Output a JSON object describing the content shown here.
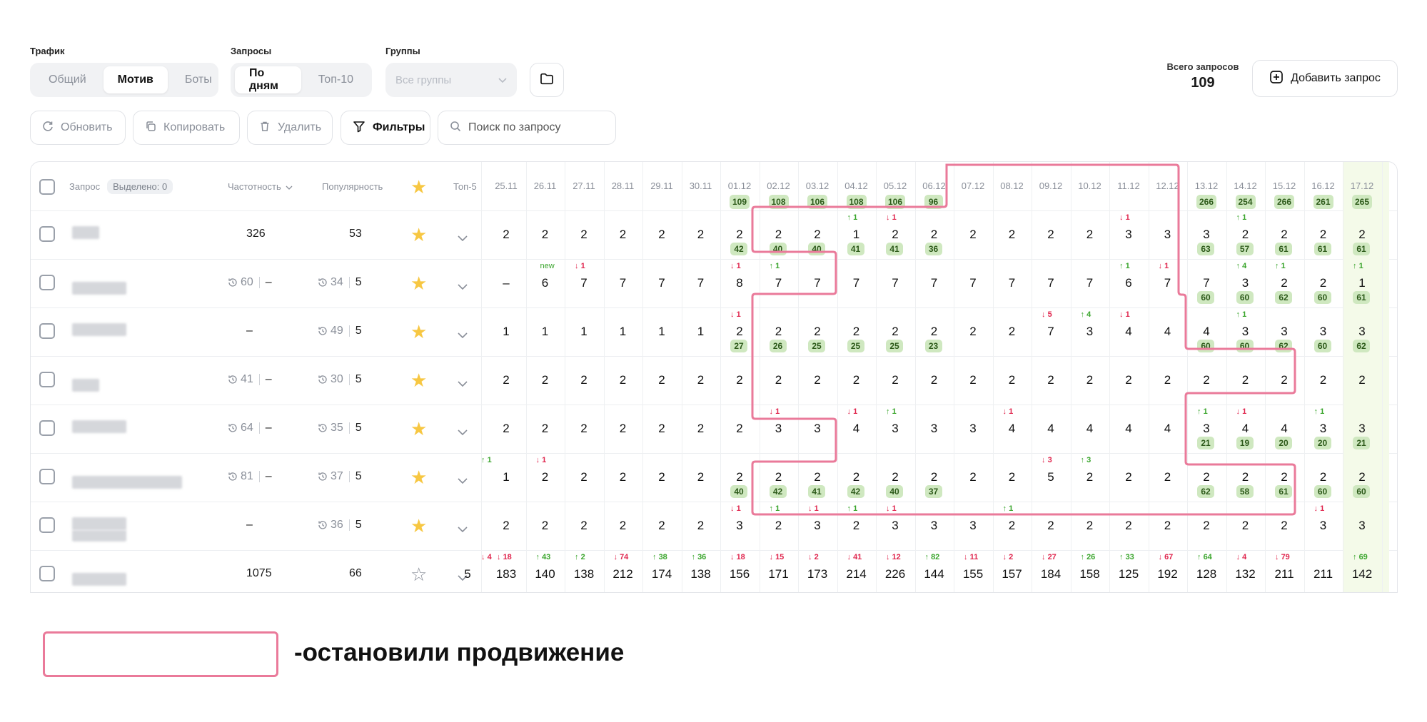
{
  "filters": {
    "traffic": {
      "label": "Трафик",
      "options": [
        "Общий",
        "Мотив",
        "Боты"
      ],
      "active": 1
    },
    "requests": {
      "label": "Запросы",
      "options": [
        "По дням",
        "Топ-10"
      ],
      "active": 0
    },
    "groups": {
      "label": "Группы",
      "placeholder": "Все группы"
    }
  },
  "summary": {
    "label": "Всего запросов",
    "value": "109"
  },
  "add_button": "Добавить запрос",
  "toolbar": {
    "refresh": "Обновить",
    "copy": "Копировать",
    "delete": "Удалить",
    "filters": "Фильтры",
    "search_placeholder": "Поиск по запросу"
  },
  "table": {
    "headers": {
      "query": "Запрос",
      "selected": "Выделено: 0",
      "frequency": "Частотность",
      "popularity": "Популярность",
      "top5": "Топ-5"
    },
    "dates": [
      "25.11",
      "26.11",
      "27.11",
      "28.11",
      "29.11",
      "30.11",
      "01.12",
      "02.12",
      "03.12",
      "04.12",
      "05.12",
      "06.12",
      "07.12",
      "08.12",
      "09.12",
      "10.12",
      "11.12",
      "12.12",
      "13.12",
      "14.12",
      "15.12",
      "16.12",
      "17.12"
    ],
    "date_badges": [
      "",
      "",
      "",
      "",
      "",
      "",
      "109",
      "108",
      "106",
      "108",
      "106",
      "96",
      "",
      "",
      "",
      "",
      "",
      "",
      "266",
      "254",
      "266",
      "261",
      "265"
    ],
    "rows": [
      {
        "freq": "326",
        "freq_hist": false,
        "freq_val": "",
        "pop": "53",
        "pop_hist": false,
        "pop_val": "",
        "star": true,
        "values": [
          "2",
          "2",
          "2",
          "2",
          "2",
          "2",
          "2",
          "2",
          "2",
          "1",
          "2",
          "2",
          "2",
          "2",
          "2",
          "2",
          "3",
          "3",
          "3",
          "2",
          "2",
          "2",
          "2"
        ],
        "badges": [
          "",
          "",
          "",
          "",
          "",
          "",
          "42",
          "40",
          "40",
          "41",
          "41",
          "36",
          "",
          "",
          "",
          "",
          "",
          "",
          "63",
          "57",
          "61",
          "61",
          "61"
        ],
        "deltas": {
          "9": [
            "up",
            "1"
          ],
          "10": [
            "down",
            "1"
          ],
          "16": [
            "down",
            "1"
          ],
          "19": [
            "up",
            "1"
          ]
        }
      },
      {
        "freq": "60",
        "freq_hist": true,
        "freq_val": "–",
        "pop": "34",
        "pop_hist": true,
        "pop_val": "5",
        "star": true,
        "values": [
          "–",
          "6",
          "7",
          "7",
          "7",
          "7",
          "8",
          "7",
          "7",
          "7",
          "7",
          "7",
          "7",
          "7",
          "7",
          "7",
          "6",
          "7",
          "7",
          "3",
          "2",
          "2",
          "1"
        ],
        "badges": [
          "",
          "",
          "",
          "",
          "",
          "",
          "",
          "",
          "",
          "",
          "",
          "",
          "",
          "",
          "",
          "",
          "",
          "",
          "60",
          "60",
          "62",
          "60",
          "61"
        ],
        "deltas": {
          "1": [
            "new",
            "new"
          ],
          "2": [
            "down",
            "1"
          ],
          "6": [
            "down",
            "1"
          ],
          "7": [
            "up",
            "1"
          ],
          "16": [
            "up",
            "1"
          ],
          "17": [
            "down",
            "1"
          ],
          "19": [
            "up",
            "4"
          ],
          "20": [
            "up",
            "1"
          ],
          "22": [
            "up",
            "1"
          ]
        }
      },
      {
        "freq": "–",
        "freq_hist": false,
        "freq_val": "",
        "pop": "49",
        "pop_hist": true,
        "pop_val": "5",
        "star": true,
        "values": [
          "1",
          "1",
          "1",
          "1",
          "1",
          "1",
          "2",
          "2",
          "2",
          "2",
          "2",
          "2",
          "2",
          "2",
          "7",
          "3",
          "4",
          "4",
          "4",
          "3",
          "3",
          "3",
          "3"
        ],
        "badges": [
          "",
          "",
          "",
          "",
          "",
          "",
          "27",
          "26",
          "25",
          "25",
          "25",
          "23",
          "",
          "",
          "",
          "",
          "",
          "",
          "60",
          "60",
          "62",
          "60",
          "62"
        ],
        "deltas": {
          "6": [
            "down",
            "1"
          ],
          "14": [
            "down",
            "5"
          ],
          "15": [
            "up",
            "4"
          ],
          "16": [
            "down",
            "1"
          ],
          "19": [
            "up",
            "1"
          ]
        }
      },
      {
        "freq": "41",
        "freq_hist": true,
        "freq_val": "–",
        "pop": "30",
        "pop_hist": true,
        "pop_val": "5",
        "star": true,
        "values": [
          "2",
          "2",
          "2",
          "2",
          "2",
          "2",
          "2",
          "2",
          "2",
          "2",
          "2",
          "2",
          "2",
          "2",
          "2",
          "2",
          "2",
          "2",
          "2",
          "2",
          "2",
          "2",
          "2"
        ],
        "badges": [
          "",
          "",
          "",
          "",
          "",
          "",
          "",
          "",
          "",
          "",
          "",
          "",
          "",
          "",
          "",
          "",
          "",
          "",
          "",
          "",
          "",
          "",
          ""
        ],
        "deltas": {}
      },
      {
        "freq": "64",
        "freq_hist": true,
        "freq_val": "–",
        "pop": "35",
        "pop_hist": true,
        "pop_val": "5",
        "star": true,
        "values": [
          "2",
          "2",
          "2",
          "2",
          "2",
          "2",
          "2",
          "3",
          "3",
          "4",
          "3",
          "3",
          "3",
          "4",
          "4",
          "4",
          "4",
          "4",
          "3",
          "4",
          "4",
          "3",
          "3"
        ],
        "badges": [
          "",
          "",
          "",
          "",
          "",
          "",
          "",
          "",
          "",
          "",
          "",
          "",
          "",
          "",
          "",
          "",
          "",
          "",
          "21",
          "19",
          "20",
          "20",
          "21"
        ],
        "deltas": {
          "7": [
            "down",
            "1"
          ],
          "9": [
            "down",
            "1"
          ],
          "10": [
            "up",
            "1"
          ],
          "13": [
            "down",
            "1"
          ],
          "18": [
            "up",
            "1"
          ],
          "19": [
            "down",
            "1"
          ],
          "21": [
            "up",
            "1"
          ]
        }
      },
      {
        "freq": "81",
        "freq_hist": true,
        "freq_val": "–",
        "pop": "37",
        "pop_hist": true,
        "pop_val": "5",
        "star": true,
        "values": [
          "1",
          "2",
          "2",
          "2",
          "2",
          "2",
          "2",
          "2",
          "2",
          "2",
          "2",
          "2",
          "2",
          "2",
          "5",
          "2",
          "2",
          "2",
          "2",
          "2",
          "2",
          "2",
          "2"
        ],
        "badges": [
          "",
          "",
          "",
          "",
          "",
          "",
          "40",
          "42",
          "41",
          "42",
          "40",
          "37",
          "",
          "",
          "",
          "",
          "",
          "",
          "62",
          "58",
          "61",
          "60",
          "60"
        ],
        "deltas": {
          "1": [
            "down",
            "1"
          ],
          "14": [
            "down",
            "3"
          ],
          "15": [
            "up",
            "3"
          ]
        }
      },
      {
        "freq": "–",
        "freq_hist": false,
        "freq_val": "",
        "pop": "36",
        "pop_hist": true,
        "pop_val": "5",
        "star": true,
        "values": [
          "2",
          "2",
          "2",
          "2",
          "2",
          "2",
          "3",
          "2",
          "3",
          "2",
          "3",
          "3",
          "3",
          "2",
          "2",
          "2",
          "2",
          "2",
          "2",
          "2",
          "2",
          "3",
          "3"
        ],
        "badges": [
          "",
          "",
          "",
          "",
          "",
          "",
          "",
          "",
          "",
          "",
          "",
          "",
          "",
          "",
          "",
          "",
          "",
          "",
          "",
          "",
          "",
          "",
          ""
        ],
        "deltas": {
          "6": [
            "down",
            "1"
          ],
          "7": [
            "up",
            "1"
          ],
          "8": [
            "down",
            "1"
          ],
          "9": [
            "up",
            "1"
          ],
          "10": [
            "down",
            "1"
          ],
          "13": [
            "up",
            "1"
          ],
          "21": [
            "down",
            "1"
          ]
        }
      },
      {
        "freq": "1075",
        "freq_hist": false,
        "freq_val": "",
        "pop": "66",
        "pop_hist": false,
        "pop_val": "",
        "star": false,
        "values": [
          "183",
          "140",
          "138",
          "212",
          "174",
          "138",
          "156",
          "171",
          "173",
          "214",
          "226",
          "144",
          "155",
          "157",
          "184",
          "158",
          "125",
          "192",
          "128",
          "132",
          "211",
          "211",
          "142"
        ],
        "badges": [
          "",
          "",
          "",
          "",
          "",
          "",
          "",
          "",
          "",
          "",
          "",
          "",
          "",
          "",
          "",
          "",
          "",
          "",
          "",
          "",
          "",
          "",
          ""
        ],
        "deltas": {
          "0": [
            "down",
            "18"
          ],
          "1": [
            "up",
            "43"
          ],
          "2": [
            "up",
            "2"
          ],
          "3": [
            "down",
            "74"
          ],
          "4": [
            "up",
            "38"
          ],
          "5": [
            "up",
            "36"
          ],
          "6": [
            "down",
            "18"
          ],
          "7": [
            "down",
            "15"
          ],
          "8": [
            "down",
            "2"
          ],
          "9": [
            "down",
            "41"
          ],
          "10": [
            "down",
            "12"
          ],
          "11": [
            "up",
            "82"
          ],
          "12": [
            "down",
            "11"
          ],
          "13": [
            "down",
            "2"
          ],
          "14": [
            "down",
            "27"
          ],
          "15": [
            "up",
            "26"
          ],
          "16": [
            "up",
            "33"
          ],
          "17": [
            "down",
            "67"
          ],
          "18": [
            "up",
            "64"
          ],
          "19": [
            "down",
            "4"
          ],
          "20": [
            "down",
            "79"
          ],
          "22": [
            "up",
            "69"
          ]
        }
      }
    ],
    "edge_left": {
      "row5_delta": "1",
      "row7_delta": "4",
      "row7_value": "5"
    }
  },
  "legend": {
    "text": "-остановили продвижение",
    "color": "#ea7a9a"
  }
}
